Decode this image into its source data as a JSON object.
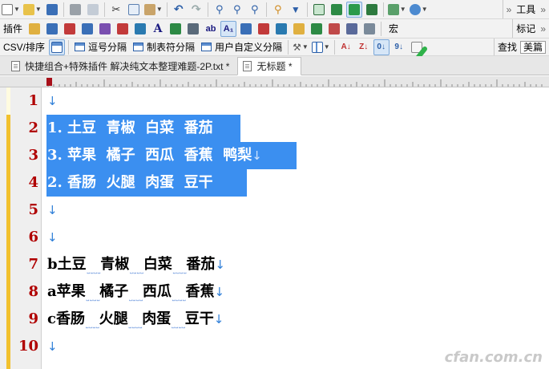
{
  "toolbar": {
    "row1_right_label": "工具",
    "row2_right_label": "标记",
    "row2_plugin_label": "插件",
    "row2_macro_label": "宏",
    "row3_right_label": "查找",
    "row3_right_value": "美篇"
  },
  "csv_bar": {
    "csv_label": "CSV/排序",
    "comma_split": "逗号分隔",
    "tab_split": "制表符分隔",
    "custom_split": "用户自定义分隔"
  },
  "tabs": [
    {
      "label": "快捷组合+特殊插件 解决纯文本整理难题-2P.txt *"
    },
    {
      "label": "无标题 *"
    }
  ],
  "lines": [
    {
      "num": "1",
      "text": "",
      "eol": "↓"
    },
    {
      "num": "2",
      "text": "1. 土豆  青椒  白菜  番茄",
      "eol": ""
    },
    {
      "num": "3",
      "text": "3. 苹果  橘子  西瓜  香蕉  鸭梨",
      "eol": "↓"
    },
    {
      "num": "4",
      "text": "2. 香肠  火腿  肉蛋  豆干",
      "eol": ""
    },
    {
      "num": "5",
      "text": "",
      "eol": "↓"
    },
    {
      "num": "6",
      "text": "",
      "eol": "↓"
    },
    {
      "num": "7",
      "prefix": "b",
      "words": [
        "土豆",
        "青椒",
        "白菜",
        "番茄"
      ],
      "eol": "↓"
    },
    {
      "num": "8",
      "prefix": "a",
      "words": [
        "苹果",
        "橘子",
        "西瓜",
        "香蕉"
      ],
      "eol": "↓"
    },
    {
      "num": "9",
      "prefix": "c",
      "words": [
        "香肠",
        "火腿",
        "肉蛋",
        "豆干"
      ],
      "eol": "↓"
    },
    {
      "num": "10",
      "text": "",
      "eol": "↓"
    }
  ],
  "space_marker": "˽˽˽˽",
  "watermark": "cfan.com.cn",
  "colors": {
    "selection": "#3b8ff0",
    "line_number": "#b00000",
    "eol_arrow": "#2f7fd8",
    "change_bar": "#f2c12e",
    "check": "#2fb24a"
  }
}
